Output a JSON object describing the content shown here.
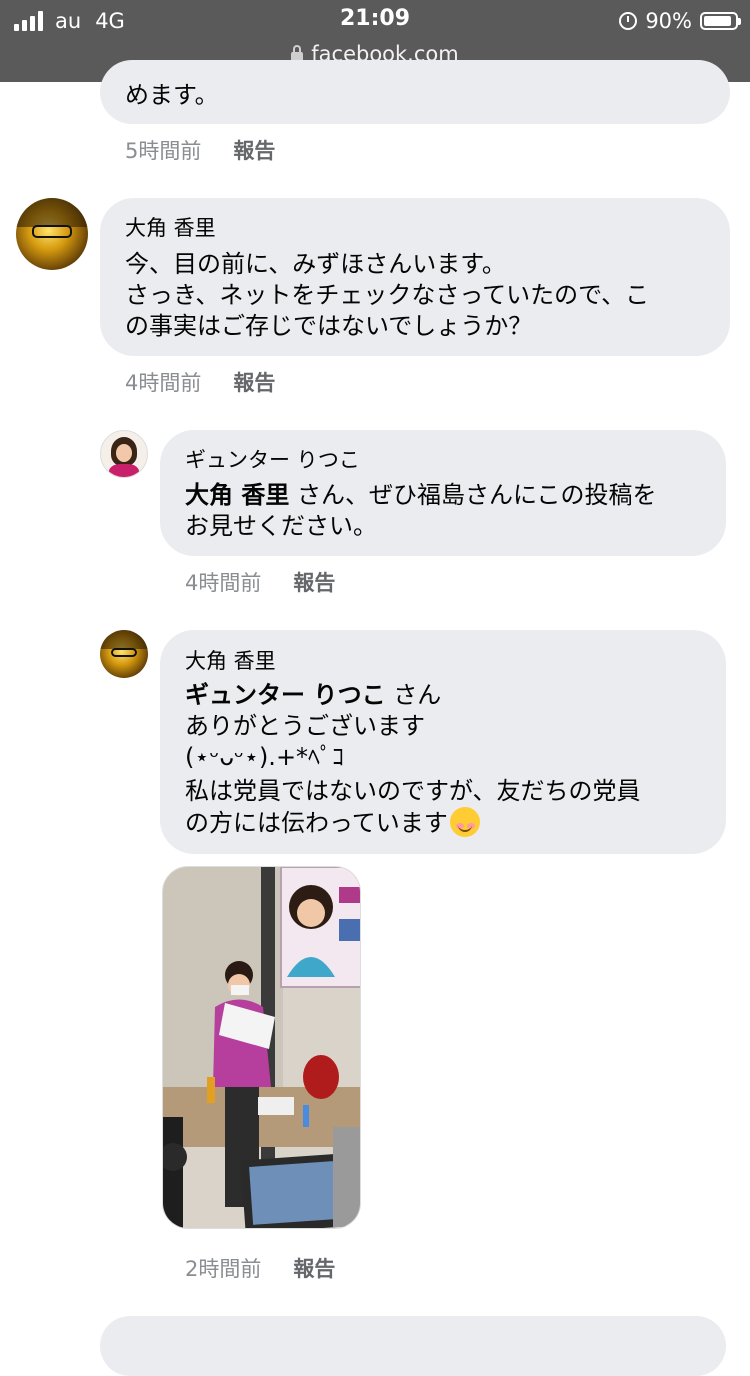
{
  "status_bar": {
    "carrier": "au",
    "network": "4G",
    "time": "21:09",
    "battery": "90%",
    "battery_level": 0.9
  },
  "url_bar": {
    "domain": "facebook.com"
  },
  "comments": [
    {
      "text_lines": [
        "めます。"
      ],
      "time": "5時間前",
      "report": "報告"
    },
    {
      "author": "大角 香里",
      "text_lines": [
        "今、目の前に、みずほさんいます。",
        "さっき、ネットをチェックなさっていたので、こ",
        "の事実はご存じではないでしょうか？"
      ],
      "time": "4時間前",
      "report": "報告"
    },
    {
      "author": "ギュンター りつこ",
      "mention": "大角 香里",
      "text_lines": [
        " さん、ぜひ福島さんにこの投稿を",
        "お見せください。"
      ],
      "time": "4時間前",
      "report": "報告"
    },
    {
      "author": "大角 香里",
      "mention": "ギュンター りつこ",
      "text_lines": [
        " さん",
        "ありがとうございます",
        "(⋆ᵕᴗᵕ⋆).+*ﾍﾟｺ",
        "私は党員ではないのですが、友だちの党員",
        "の方には伝わっています"
      ],
      "emoji": "smiling-face",
      "time": "2時間前",
      "report": "報告"
    }
  ],
  "colors": {
    "topbar": "#5a5a5a",
    "bubble": "#ebecef",
    "meta_text": "#8a8d91"
  }
}
